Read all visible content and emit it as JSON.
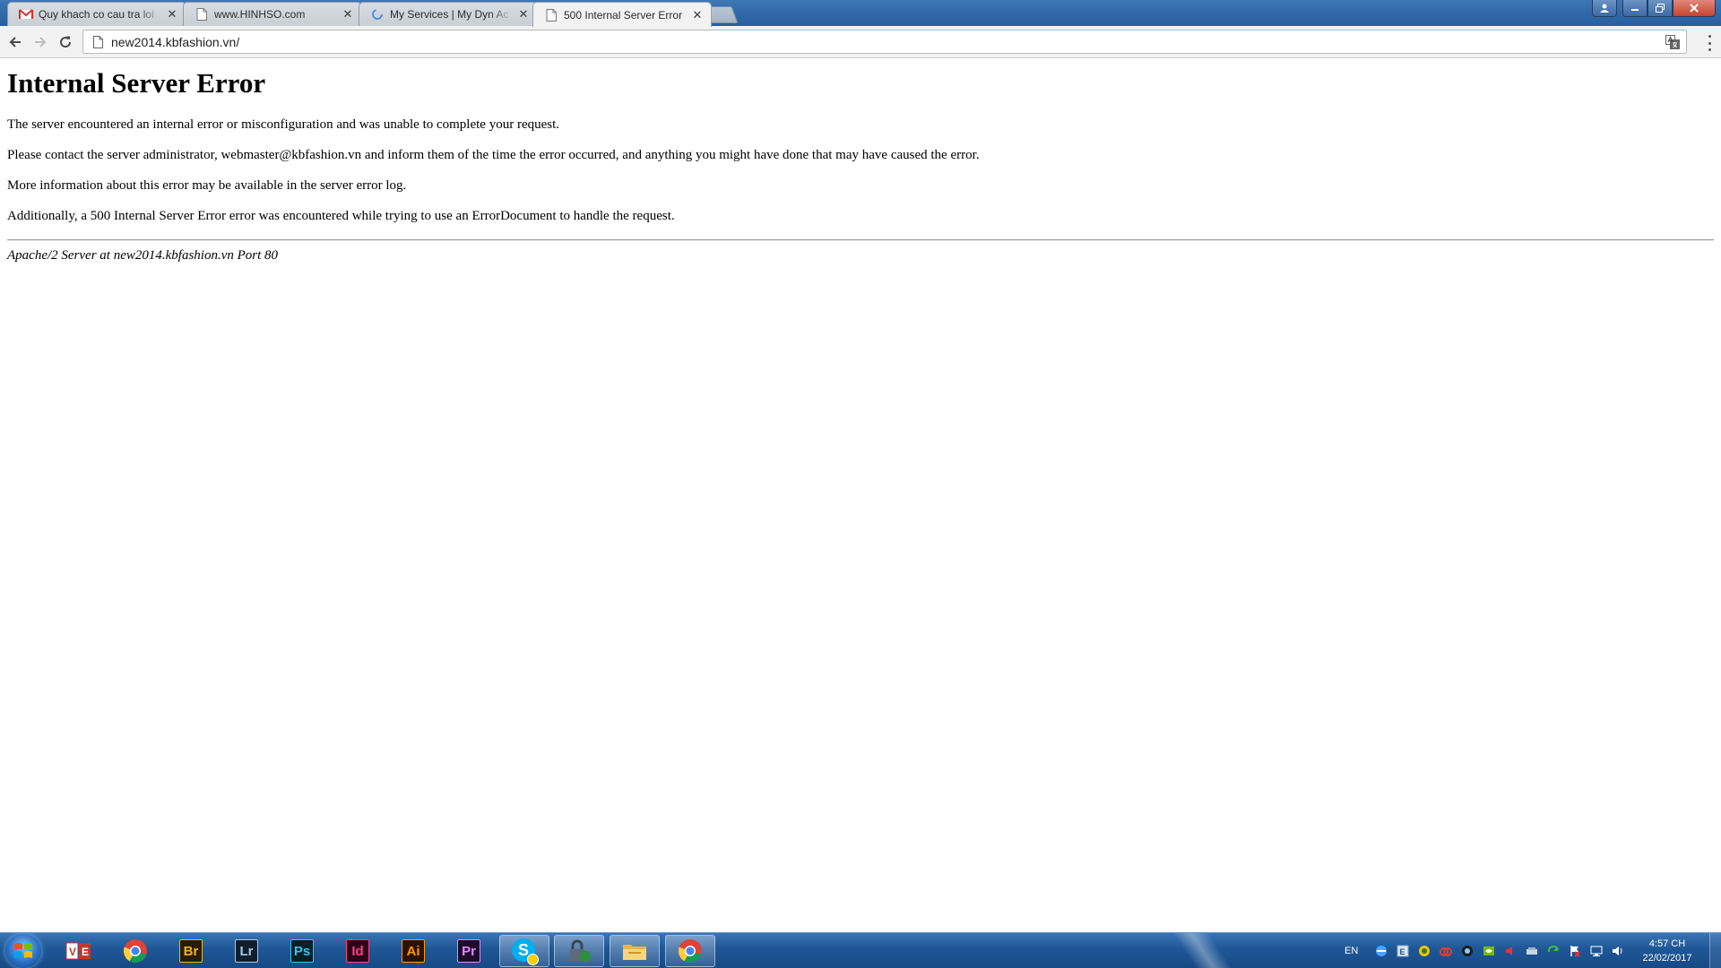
{
  "browser": {
    "tabs": [
      {
        "title": "Quy khach co cau tra loi",
        "icon": "gmail-icon",
        "close": "✕"
      },
      {
        "title": "www.HINHSO.com",
        "icon": "page-icon",
        "close": "✕"
      },
      {
        "title": "My Services | My Dyn Ac",
        "icon": "loading-icon",
        "close": "✕"
      },
      {
        "title": "500 Internal Server Error",
        "icon": "page-icon",
        "close": "✕"
      }
    ],
    "address": "new2014.kbfashion.vn/"
  },
  "page": {
    "heading": "Internal Server Error",
    "paragraphs": [
      "The server encountered an internal error or misconfiguration and was unable to complete your request.",
      "Please contact the server administrator, webmaster@kbfashion.vn and inform them of the time the error occurred, and anything you might have done that may have caused the error.",
      "More information about this error may be available in the server error log.",
      "Additionally, a 500 Internal Server Error error was encountered while trying to use an ErrorDocument to handle the request."
    ],
    "footer": "Apache/2 Server at new2014.kbfashion.vn Port 80"
  },
  "taskbar": {
    "apps": [
      {
        "name": "unikey",
        "label": ""
      },
      {
        "name": "chrome",
        "label": ""
      },
      {
        "name": "bridge",
        "label": "Br"
      },
      {
        "name": "lightroom",
        "label": "Lr"
      },
      {
        "name": "photoshop",
        "label": "Ps"
      },
      {
        "name": "indesign",
        "label": "Id"
      },
      {
        "name": "illustrator",
        "label": "Ai"
      },
      {
        "name": "premiere",
        "label": "Pr"
      },
      {
        "name": "skype",
        "label": "S"
      },
      {
        "name": "vpn-lock",
        "label": ""
      },
      {
        "name": "file-explorer",
        "label": ""
      },
      {
        "name": "chrome-active",
        "label": ""
      }
    ],
    "language": "EN",
    "time": "4:57 CH",
    "date": "22/02/2017"
  },
  "colors": {
    "taskbar": "#1f5796",
    "titlebar": "#2f67a8",
    "bridge": "#f0b41c",
    "lightroom": "#a5c8e8",
    "photoshop": "#31c5f0",
    "indesign": "#ff3d8b",
    "illustrator": "#ff9a00",
    "premiere": "#e08aff"
  }
}
